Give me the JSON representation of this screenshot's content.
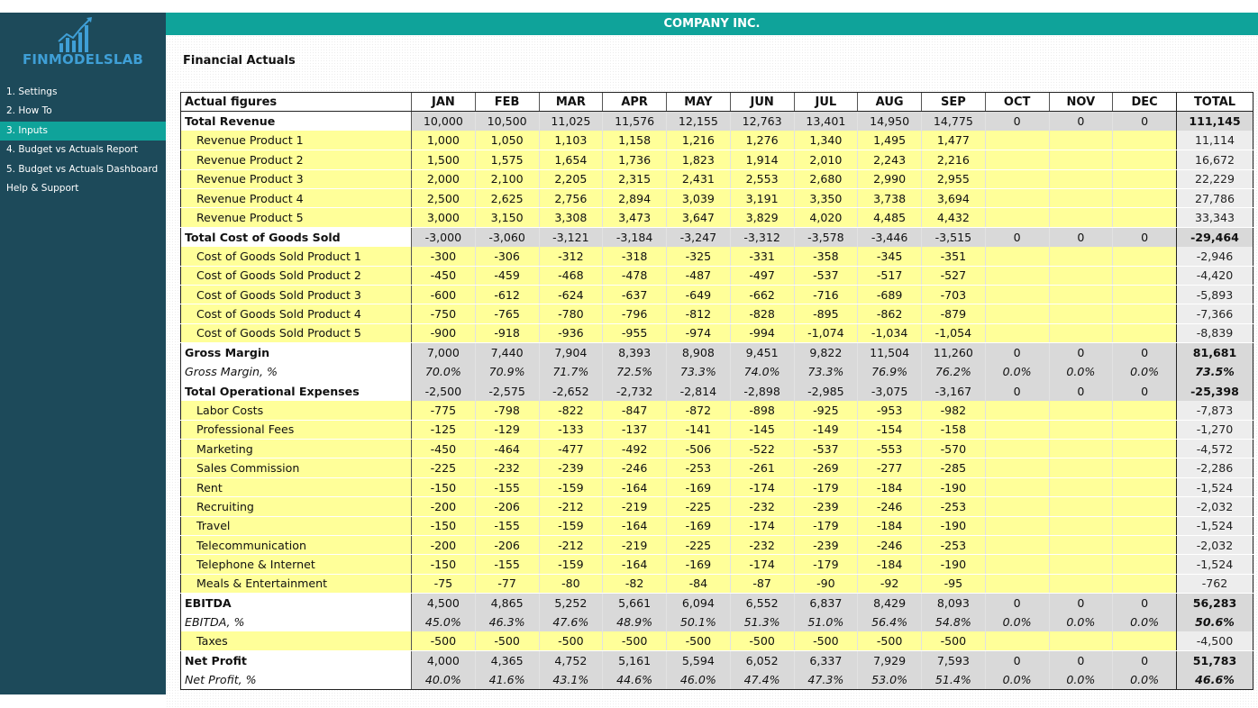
{
  "app": {
    "logo_text": "FINMODELSLAB",
    "company": "COMPANY INC.",
    "section_title": "Financial Actuals"
  },
  "colors": {
    "sidebar_bg": "#1d4a5a",
    "accent": "#0fa39a",
    "logo": "#3f9fd6",
    "input_cell": "#ffff99",
    "calc_cell": "#d9d9d9"
  },
  "nav": {
    "items": [
      {
        "label": "1. Settings",
        "active": false
      },
      {
        "label": "2. How To",
        "active": false
      },
      {
        "label": "3. Inputs",
        "active": true
      },
      {
        "label": "4. Budget vs Actuals Report",
        "active": false
      },
      {
        "label": "5. Budget vs Actuals Dashboard",
        "active": false
      },
      {
        "label": "Help & Support",
        "active": false
      }
    ]
  },
  "table": {
    "header": {
      "label": "Actual figures",
      "months": [
        "JAN",
        "FEB",
        "MAR",
        "APR",
        "MAY",
        "JUN",
        "JUL",
        "AUG",
        "SEP",
        "OCT",
        "NOV",
        "DEC"
      ],
      "total": "TOTAL"
    },
    "rows": [
      {
        "kind": "total",
        "label": "Total Revenue",
        "values": [
          "10,000",
          "10,500",
          "11,025",
          "11,576",
          "12,155",
          "12,763",
          "13,401",
          "14,950",
          "14,775",
          "0",
          "0",
          "0"
        ],
        "total": "111,145"
      },
      {
        "kind": "detail",
        "label": "Revenue Product 1",
        "values": [
          "1,000",
          "1,050",
          "1,103",
          "1,158",
          "1,216",
          "1,276",
          "1,340",
          "1,495",
          "1,477",
          "",
          "",
          ""
        ],
        "total": "11,114"
      },
      {
        "kind": "detail",
        "label": "Revenue Product 2",
        "values": [
          "1,500",
          "1,575",
          "1,654",
          "1,736",
          "1,823",
          "1,914",
          "2,010",
          "2,243",
          "2,216",
          "",
          "",
          ""
        ],
        "total": "16,672"
      },
      {
        "kind": "detail",
        "label": "Revenue Product 3",
        "values": [
          "2,000",
          "2,100",
          "2,205",
          "2,315",
          "2,431",
          "2,553",
          "2,680",
          "2,990",
          "2,955",
          "",
          "",
          ""
        ],
        "total": "22,229"
      },
      {
        "kind": "detail",
        "label": "Revenue Product 4",
        "values": [
          "2,500",
          "2,625",
          "2,756",
          "2,894",
          "3,039",
          "3,191",
          "3,350",
          "3,738",
          "3,694",
          "",
          "",
          ""
        ],
        "total": "27,786"
      },
      {
        "kind": "detail",
        "label": "Revenue Product 5",
        "values": [
          "3,000",
          "3,150",
          "3,308",
          "3,473",
          "3,647",
          "3,829",
          "4,020",
          "4,485",
          "4,432",
          "",
          "",
          ""
        ],
        "total": "33,343"
      },
      {
        "kind": "total",
        "label": "Total Cost of Goods Sold",
        "values": [
          "-3,000",
          "-3,060",
          "-3,121",
          "-3,184",
          "-3,247",
          "-3,312",
          "-3,578",
          "-3,446",
          "-3,515",
          "0",
          "0",
          "0"
        ],
        "total": "-29,464"
      },
      {
        "kind": "detail",
        "label": "Cost of Goods Sold Product 1",
        "values": [
          "-300",
          "-306",
          "-312",
          "-318",
          "-325",
          "-331",
          "-358",
          "-345",
          "-351",
          "",
          "",
          ""
        ],
        "total": "-2,946"
      },
      {
        "kind": "detail",
        "label": "Cost of Goods Sold Product 2",
        "values": [
          "-450",
          "-459",
          "-468",
          "-478",
          "-487",
          "-497",
          "-537",
          "-517",
          "-527",
          "",
          "",
          ""
        ],
        "total": "-4,420"
      },
      {
        "kind": "detail",
        "label": "Cost of Goods Sold Product 3",
        "values": [
          "-600",
          "-612",
          "-624",
          "-637",
          "-649",
          "-662",
          "-716",
          "-689",
          "-703",
          "",
          "",
          ""
        ],
        "total": "-5,893"
      },
      {
        "kind": "detail",
        "label": "Cost of Goods Sold Product 4",
        "values": [
          "-750",
          "-765",
          "-780",
          "-796",
          "-812",
          "-828",
          "-895",
          "-862",
          "-879",
          "",
          "",
          ""
        ],
        "total": "-7,366"
      },
      {
        "kind": "detail",
        "label": "Cost of Goods Sold Product 5",
        "values": [
          "-900",
          "-918",
          "-936",
          "-955",
          "-974",
          "-994",
          "-1,074",
          "-1,034",
          "-1,054",
          "",
          "",
          ""
        ],
        "total": "-8,839"
      },
      {
        "kind": "total",
        "label": "Gross Margin",
        "values": [
          "7,000",
          "7,440",
          "7,904",
          "8,393",
          "8,908",
          "9,451",
          "9,822",
          "11,504",
          "11,260",
          "0",
          "0",
          "0"
        ],
        "total": "81,681"
      },
      {
        "kind": "pct",
        "label": "Gross Margin, %",
        "values": [
          "70.0%",
          "70.9%",
          "71.7%",
          "72.5%",
          "73.3%",
          "74.0%",
          "73.3%",
          "76.9%",
          "76.2%",
          "0.0%",
          "0.0%",
          "0.0%"
        ],
        "total": "73.5%"
      },
      {
        "kind": "total",
        "label": "Total Operational Expenses",
        "values": [
          "-2,500",
          "-2,575",
          "-2,652",
          "-2,732",
          "-2,814",
          "-2,898",
          "-2,985",
          "-3,075",
          "-3,167",
          "0",
          "0",
          "0"
        ],
        "total": "-25,398"
      },
      {
        "kind": "detail",
        "label": "Labor Costs",
        "values": [
          "-775",
          "-798",
          "-822",
          "-847",
          "-872",
          "-898",
          "-925",
          "-953",
          "-982",
          "",
          "",
          ""
        ],
        "total": "-7,873"
      },
      {
        "kind": "detail",
        "label": "Professional Fees",
        "values": [
          "-125",
          "-129",
          "-133",
          "-137",
          "-141",
          "-145",
          "-149",
          "-154",
          "-158",
          "",
          "",
          ""
        ],
        "total": "-1,270"
      },
      {
        "kind": "detail",
        "label": "Marketing",
        "values": [
          "-450",
          "-464",
          "-477",
          "-492",
          "-506",
          "-522",
          "-537",
          "-553",
          "-570",
          "",
          "",
          ""
        ],
        "total": "-4,572"
      },
      {
        "kind": "detail",
        "label": "Sales Commission",
        "values": [
          "-225",
          "-232",
          "-239",
          "-246",
          "-253",
          "-261",
          "-269",
          "-277",
          "-285",
          "",
          "",
          ""
        ],
        "total": "-2,286"
      },
      {
        "kind": "detail",
        "label": "Rent",
        "values": [
          "-150",
          "-155",
          "-159",
          "-164",
          "-169",
          "-174",
          "-179",
          "-184",
          "-190",
          "",
          "",
          ""
        ],
        "total": "-1,524"
      },
      {
        "kind": "detail",
        "label": "Recruiting",
        "values": [
          "-200",
          "-206",
          "-212",
          "-219",
          "-225",
          "-232",
          "-239",
          "-246",
          "-253",
          "",
          "",
          ""
        ],
        "total": "-2,032"
      },
      {
        "kind": "detail",
        "label": "Travel",
        "values": [
          "-150",
          "-155",
          "-159",
          "-164",
          "-169",
          "-174",
          "-179",
          "-184",
          "-190",
          "",
          "",
          ""
        ],
        "total": "-1,524"
      },
      {
        "kind": "detail",
        "label": "Telecommunication",
        "values": [
          "-200",
          "-206",
          "-212",
          "-219",
          "-225",
          "-232",
          "-239",
          "-246",
          "-253",
          "",
          "",
          ""
        ],
        "total": "-2,032"
      },
      {
        "kind": "detail",
        "label": "Telephone & Internet",
        "values": [
          "-150",
          "-155",
          "-159",
          "-164",
          "-169",
          "-174",
          "-179",
          "-184",
          "-190",
          "",
          "",
          ""
        ],
        "total": "-1,524"
      },
      {
        "kind": "detail",
        "label": "Meals & Entertainment",
        "values": [
          "-75",
          "-77",
          "-80",
          "-82",
          "-84",
          "-87",
          "-90",
          "-92",
          "-95",
          "",
          "",
          ""
        ],
        "total": "-762"
      },
      {
        "kind": "total",
        "label": "EBITDA",
        "values": [
          "4,500",
          "4,865",
          "5,252",
          "5,661",
          "6,094",
          "6,552",
          "6,837",
          "8,429",
          "8,093",
          "0",
          "0",
          "0"
        ],
        "total": "56,283"
      },
      {
        "kind": "pct",
        "label": "EBITDA, %",
        "values": [
          "45.0%",
          "46.3%",
          "47.6%",
          "48.9%",
          "50.1%",
          "51.3%",
          "51.0%",
          "56.4%",
          "54.8%",
          "0.0%",
          "0.0%",
          "0.0%"
        ],
        "total": "50.6%"
      },
      {
        "kind": "detail",
        "label": "Taxes",
        "values": [
          "-500",
          "-500",
          "-500",
          "-500",
          "-500",
          "-500",
          "-500",
          "-500",
          "-500",
          "",
          "",
          ""
        ],
        "total": "-4,500"
      },
      {
        "kind": "total",
        "label": "Net Profit",
        "values": [
          "4,000",
          "4,365",
          "4,752",
          "5,161",
          "5,594",
          "6,052",
          "6,337",
          "7,929",
          "7,593",
          "0",
          "0",
          "0"
        ],
        "total": "51,783"
      },
      {
        "kind": "pct",
        "label": "Net Profit, %",
        "values": [
          "40.0%",
          "41.6%",
          "43.1%",
          "44.6%",
          "46.0%",
          "47.4%",
          "47.3%",
          "53.0%",
          "51.4%",
          "0.0%",
          "0.0%",
          "0.0%"
        ],
        "total": "46.6%"
      }
    ]
  }
}
